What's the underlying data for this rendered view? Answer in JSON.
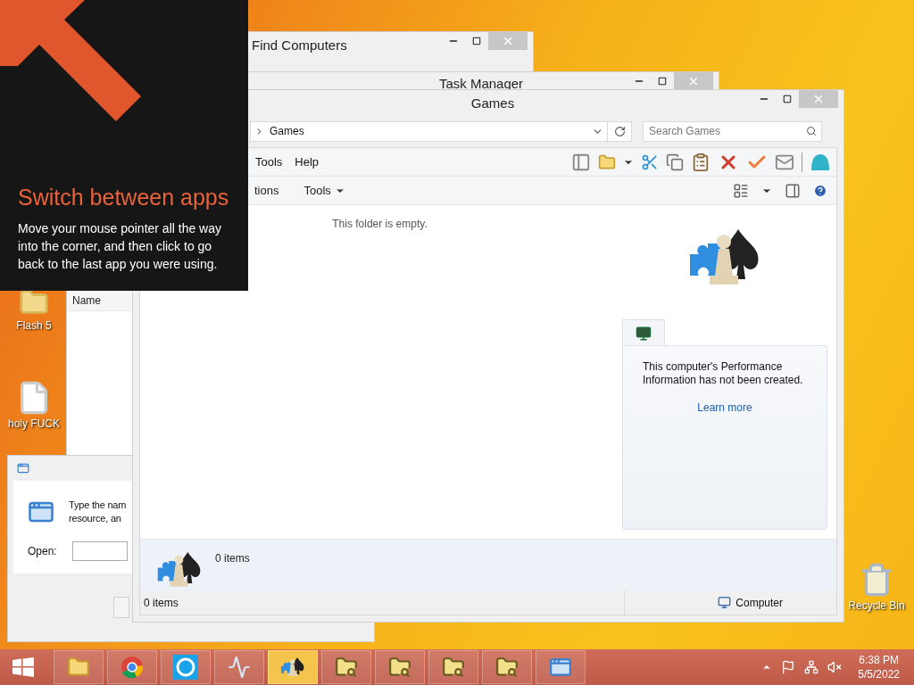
{
  "desktop": {
    "icons": [
      {
        "label": "Flash 5",
        "kind": "folder"
      },
      {
        "label": "holy FUCK",
        "kind": "file"
      },
      {
        "label": "Recycle Bin",
        "kind": "recycle"
      }
    ]
  },
  "charm_tip": {
    "title": "Switch between apps",
    "body": "Move your mouse pointer all the way into the corner, and then click to go back to the last app you were using."
  },
  "find_computers": {
    "title": "Find Computers"
  },
  "task_manager": {
    "title": "Task Manager"
  },
  "list_window": {
    "column": "Name"
  },
  "run_dialog": {
    "prompt": [
      "Type the nam",
      "resource, an"
    ],
    "open_label": "Open:"
  },
  "games_window": {
    "title": "Games",
    "breadcrumb": "Games",
    "search_placeholder": "Search Games",
    "menu": [
      "Tools",
      "Help"
    ],
    "commands": [
      {
        "label": "tions",
        "dropdown": false
      },
      {
        "label": "Tools",
        "dropdown": true
      }
    ],
    "empty_message": "This folder is empty.",
    "performance": {
      "text": "This computer's Performance Information has not been created.",
      "link": "Learn more"
    },
    "details": {
      "count": "0 items"
    },
    "status_bar": {
      "count": "0 items",
      "zone": "Computer"
    }
  },
  "taskbar": {
    "items": [
      {
        "kind": "explorer",
        "selected": false
      },
      {
        "kind": "browser",
        "selected": false
      },
      {
        "kind": "chat",
        "selected": false
      },
      {
        "kind": "monitor",
        "selected": false
      },
      {
        "kind": "games",
        "selected": true
      },
      {
        "kind": "search",
        "selected": false
      },
      {
        "kind": "search",
        "selected": false
      },
      {
        "kind": "search",
        "selected": false
      },
      {
        "kind": "search",
        "selected": false
      },
      {
        "kind": "run",
        "selected": false
      }
    ],
    "clock": {
      "time": "6:38 PM",
      "date": "5/5/2022"
    }
  }
}
